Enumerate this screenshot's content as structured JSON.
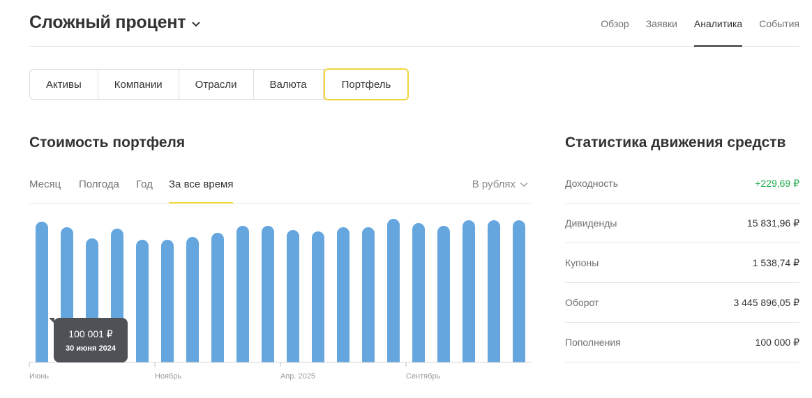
{
  "header": {
    "title": "Сложный процент",
    "nav": [
      "Обзор",
      "Заявки",
      "Аналитика",
      "События"
    ],
    "active_nav": "Аналитика"
  },
  "segments": [
    "Активы",
    "Компании",
    "Отрасли",
    "Валюта",
    "Портфель"
  ],
  "active_segment": "Портфель",
  "portfolio": {
    "title": "Стоимость портфеля",
    "period_tabs": [
      "Месяц",
      "Полгода",
      "Год",
      "За все время"
    ],
    "active_period": "За все время",
    "currency_select": "В рублях",
    "tooltip": {
      "value": "100 001 ₽",
      "date": "30 июня 2024"
    }
  },
  "chart_data": {
    "type": "bar",
    "bar_color": "#66a6df",
    "values": [
      101,
      97,
      89,
      96,
      88,
      88,
      90,
      93,
      98,
      98,
      95,
      94,
      97,
      97,
      103,
      100,
      98,
      102,
      102,
      102
    ],
    "x_ticks": [
      {
        "index": 0,
        "label": "Июнь"
      },
      {
        "index": 5,
        "label": "Ноябрь"
      },
      {
        "index": 10,
        "label": "Апр. 2025"
      },
      {
        "index": 15,
        "label": "Сентябрь"
      }
    ],
    "ylim": [
      0,
      105
    ],
    "grid": false,
    "legend": "none"
  },
  "stats": {
    "title": "Статистика движения средств",
    "rows": [
      {
        "label": "Доходность",
        "value": "+229,69 ₽",
        "positive": true
      },
      {
        "label": "Дивиденды",
        "value": "15 831,96 ₽"
      },
      {
        "label": "Купоны",
        "value": "1 538,74 ₽"
      },
      {
        "label": "Оборот",
        "value": "3 445 896,05 ₽"
      },
      {
        "label": "Пополнения",
        "value": "100 000 ₽"
      }
    ]
  },
  "colors": {
    "accent_yellow": "#f2d63a",
    "positive_green": "#1fa84a",
    "tooltip_bg": "#4e5257"
  }
}
